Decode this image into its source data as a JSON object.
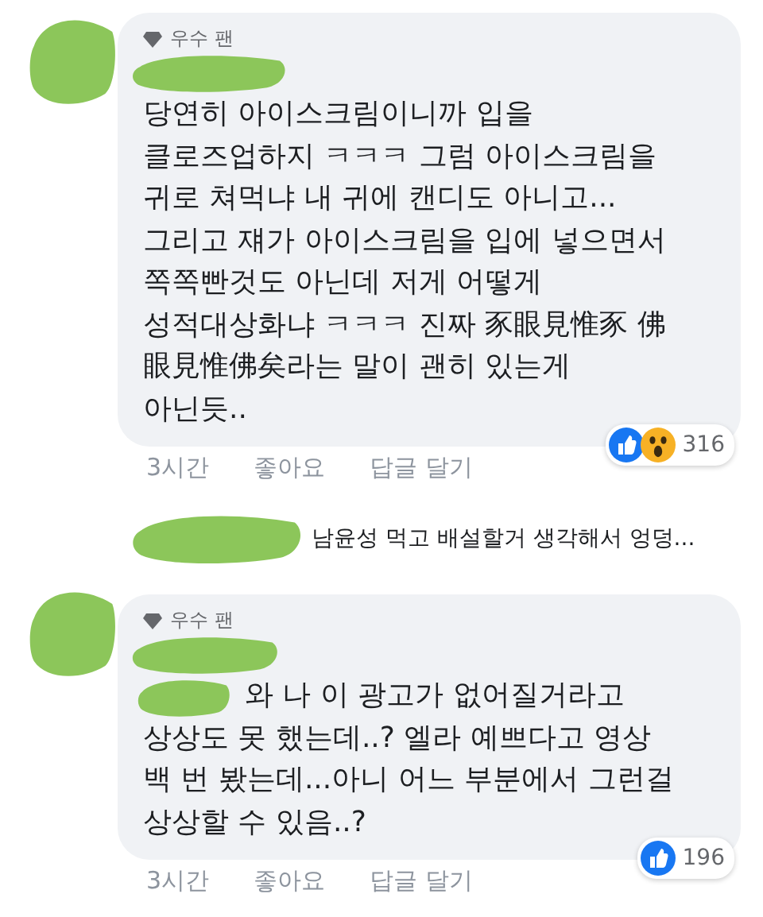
{
  "comments": [
    {
      "badge": "우수 팬",
      "hidden_prefix": false,
      "lines": [
        "당연히 아이스크림이니까 입을",
        "클로즈업하지 ㅋㅋㅋ 그럼 아이스크림을",
        "귀로 쳐먹냐 내 귀에 캔디도 아니고...",
        "그리고 쟤가 아이스크림을 입에 넣으면서",
        "쪽쪽빤것도 아닌데 저게 어떻게",
        "성적대상화냐 ㅋㅋㅋ 진짜 豕眼見惟豕 佛",
        "眼見惟佛矣라는 말이 괜히 있는게",
        "아닌듯.."
      ],
      "time": "3시간",
      "actions": [
        "좋아요",
        "답글 달기"
      ],
      "reactions": [
        {
          "kind": "like"
        },
        {
          "kind": "wow"
        }
      ],
      "reaction_count": "316"
    },
    {
      "badge": "우수 팬",
      "hidden_prefix": true,
      "lines": [
        "와 나 이 광고가 없어질거라고",
        "상상도 못 했는데..? 엘라 예쁘다고 영상",
        "백 번 봤는데...아니 어느 부분에서 그런걸",
        "상상할 수 있음..?"
      ],
      "time": "3시간",
      "actions": [
        "좋아요",
        "답글 달기"
      ],
      "reactions": [
        {
          "kind": "like"
        }
      ],
      "reaction_count": "196"
    }
  ],
  "reply_preview": {
    "text": "남윤성 먹고 배설할거 생각해서 엉덩..."
  }
}
